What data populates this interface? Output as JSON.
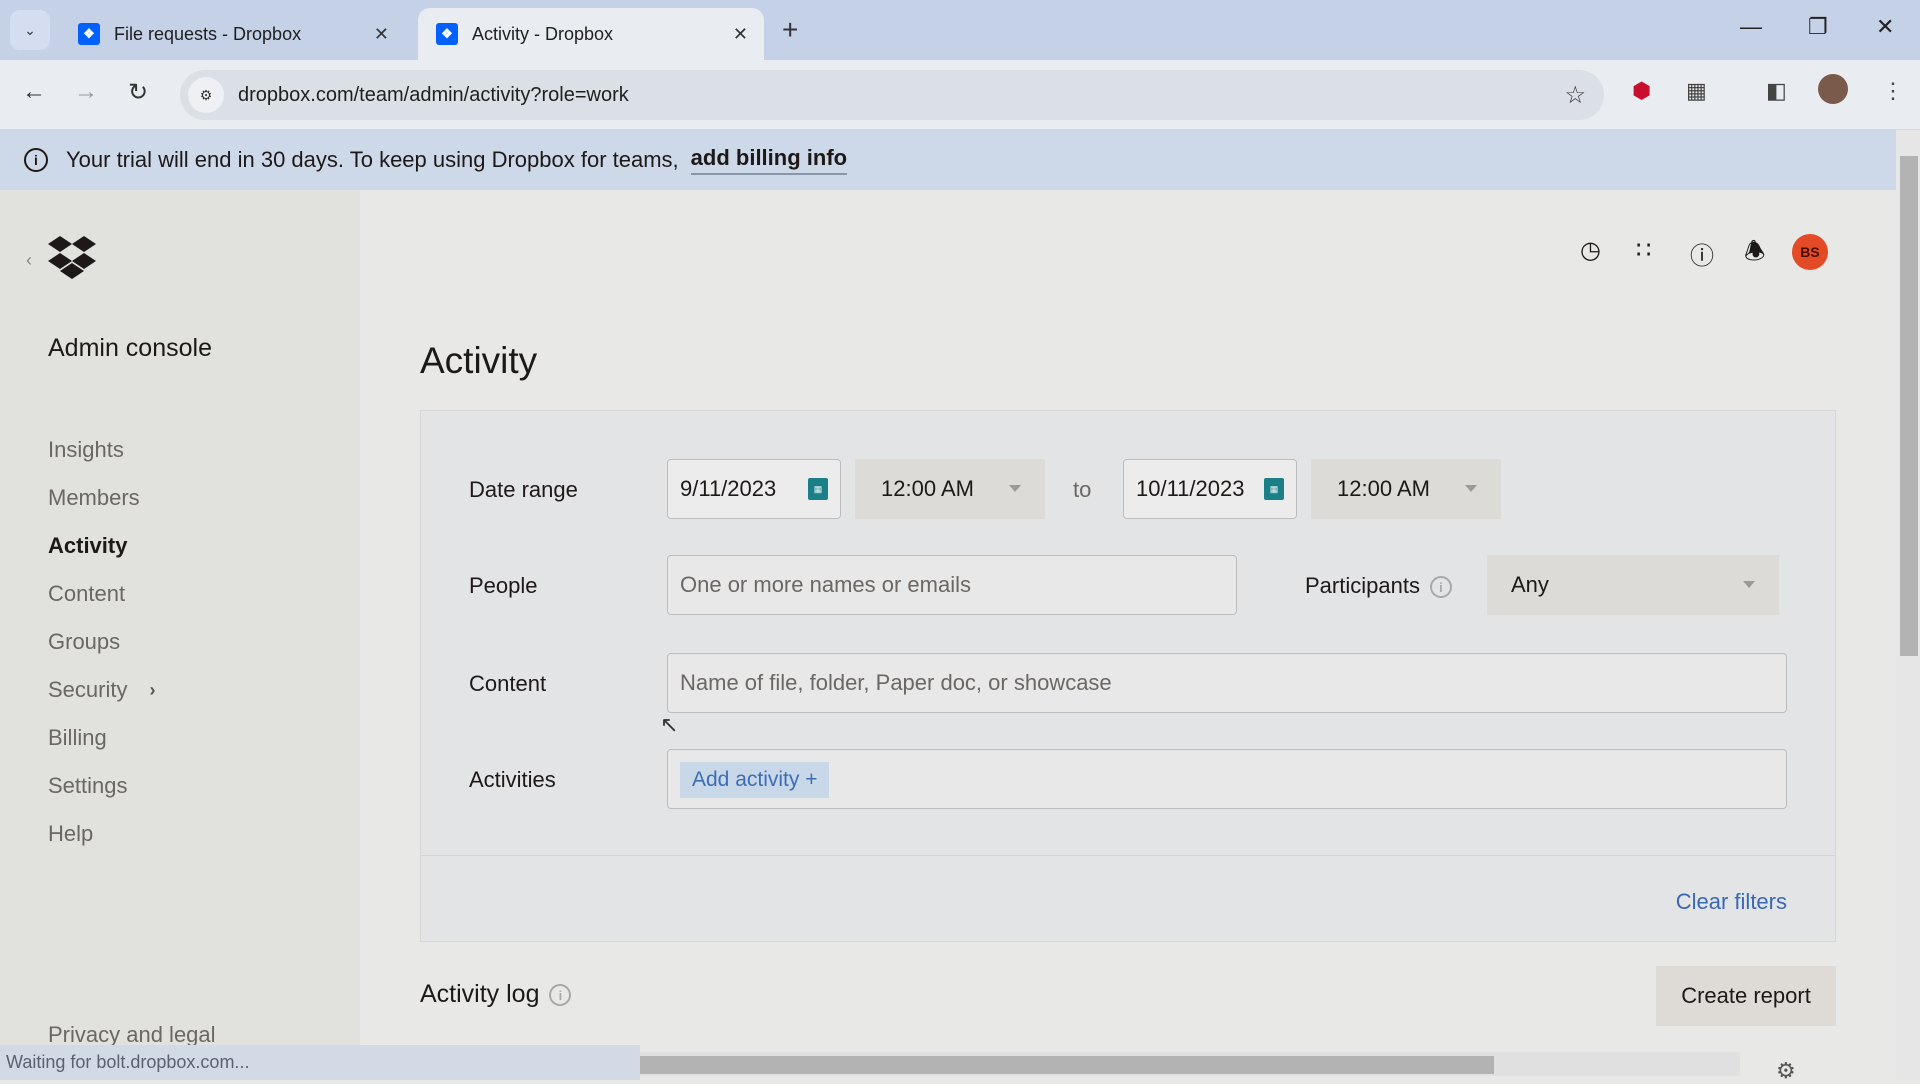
{
  "browser": {
    "tabs": [
      {
        "label": "File requests - Dropbox",
        "active": false
      },
      {
        "label": "Activity - Dropbox",
        "active": true
      }
    ],
    "url": "dropbox.com/team/admin/activity?role=work",
    "status_text": "Waiting for bolt.dropbox.com..."
  },
  "banner": {
    "message": "Your trial will end in 30 days. To keep using Dropbox for teams,",
    "link": "add billing info"
  },
  "sidebar": {
    "title": "Admin console",
    "items": [
      {
        "label": "Insights"
      },
      {
        "label": "Members"
      },
      {
        "label": "Activity",
        "active": true
      },
      {
        "label": "Content"
      },
      {
        "label": "Groups"
      },
      {
        "label": "Security",
        "has_submenu": true
      },
      {
        "label": "Billing"
      },
      {
        "label": "Settings"
      },
      {
        "label": "Help"
      }
    ],
    "footer": "Privacy and legal"
  },
  "header": {
    "avatar_initials": "BS",
    "avatar_color": "#e34b26",
    "icons": [
      "clock-icon",
      "app-grid-icon",
      "help-icon",
      "bell-icon"
    ]
  },
  "main": {
    "title": "Activity",
    "filters": {
      "date_range_label": "Date range",
      "start_date": "9/11/2023",
      "start_time": "12:00 AM",
      "to_label": "to",
      "end_date": "10/11/2023",
      "end_time": "12:00 AM",
      "people_label": "People",
      "people_placeholder": "One or more names or emails",
      "participants_label": "Participants",
      "participants_value": "Any",
      "content_label": "Content",
      "content_placeholder": "Name of file, folder, Paper doc, or showcase",
      "activities_label": "Activities",
      "add_activity": "Add activity +",
      "clear_filters": "Clear filters"
    },
    "activity_log_title": "Activity log",
    "create_report": "Create report"
  }
}
